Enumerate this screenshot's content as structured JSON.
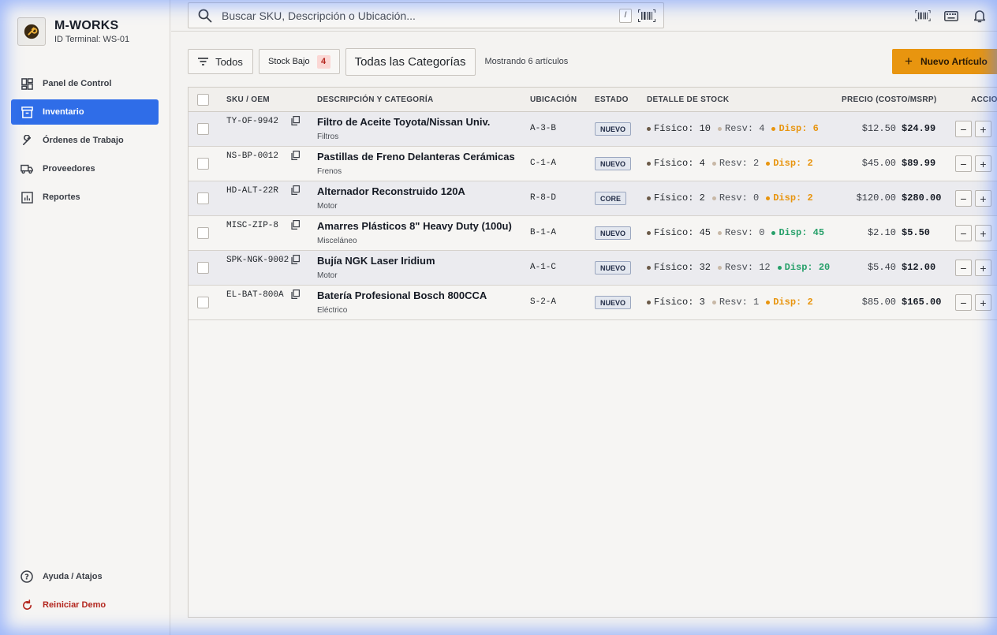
{
  "brand": {
    "name": "M-WORKS",
    "terminal": "ID Terminal: WS-01"
  },
  "nav": {
    "items": [
      {
        "label": "Panel de Control",
        "icon": "dashboard-icon"
      },
      {
        "label": "Inventario",
        "icon": "inventory-box-icon",
        "active": true
      },
      {
        "label": "Órdenes de Trabajo",
        "icon": "wrench-icon"
      },
      {
        "label": "Proveedores",
        "icon": "truck-icon"
      },
      {
        "label": "Reportes",
        "icon": "report-chart-icon"
      }
    ],
    "help": "Ayuda / Atajos",
    "reset": "Reiniciar Demo"
  },
  "search": {
    "placeholder": "Buscar SKU, Descripción o Ubicación...",
    "shortcut": "/"
  },
  "filters": {
    "all": "Todos",
    "low_stock": "Stock Bajo",
    "low_stock_count": "4",
    "categories": "Todas las Categorías",
    "showing": "Mostrando 6 artículos"
  },
  "new_item": "Nuevo Artículo",
  "columns": {
    "sku": "SKU / OEM",
    "desc": "DESCRIPCIÓN Y CATEGORÍA",
    "loc": "UBICACIÓN",
    "estado": "ESTADO",
    "stock": "DETALLE DE STOCK",
    "price": "PRECIO (COSTO/MSRP)",
    "actions": "ACCIO"
  },
  "rows": [
    {
      "sku": "TY-OF-9942",
      "desc": "Filtro de Aceite Toyota/Nissan Univ.",
      "cat": "Filtros",
      "loc": "A-3-B",
      "estado": "NUEVO",
      "fisico": "Físico: 10",
      "resv": "Resv: 4",
      "disp": "Disp: 6",
      "disp_status": "low",
      "cost": "$12.50",
      "msrp": "$24.99"
    },
    {
      "sku": "NS-BP-0012",
      "desc": "Pastillas de Freno Delanteras Cerámicas",
      "cat": "Frenos",
      "loc": "C-1-A",
      "estado": "NUEVO",
      "fisico": "Físico: 4",
      "resv": "Resv: 2",
      "disp": "Disp: 2",
      "disp_status": "low",
      "cost": "$45.00",
      "msrp": "$89.99"
    },
    {
      "sku": "HD-ALT-22R",
      "desc": "Alternador Reconstruido 120A",
      "cat": "Motor",
      "loc": "R-8-D",
      "estado": "CORE",
      "fisico": "Físico: 2",
      "resv": "Resv: 0",
      "disp": "Disp: 2",
      "disp_status": "low",
      "cost": "$120.00",
      "msrp": "$280.00"
    },
    {
      "sku": "MISC-ZIP-8",
      "desc": "Amarres Plásticos 8\" Heavy Duty (100u)",
      "cat": "Misceláneo",
      "loc": "B-1-A",
      "estado": "NUEVO",
      "fisico": "Físico: 45",
      "resv": "Resv: 0",
      "disp": "Disp: 45",
      "disp_status": "ok",
      "cost": "$2.10",
      "msrp": "$5.50"
    },
    {
      "sku": "SPK-NGK-9002",
      "desc": "Bujía NGK Laser Iridium",
      "cat": "Motor",
      "loc": "A-1-C",
      "estado": "NUEVO",
      "fisico": "Físico: 32",
      "resv": "Resv: 12",
      "disp": "Disp: 20",
      "disp_status": "ok",
      "cost": "$5.40",
      "msrp": "$12.00"
    },
    {
      "sku": "EL-BAT-800A",
      "desc": "Batería Profesional Bosch 800CCA",
      "cat": "Eléctrico",
      "loc": "S-2-A",
      "estado": "NUEVO",
      "fisico": "Físico: 3",
      "resv": "Resv: 1",
      "disp": "Disp: 2",
      "disp_status": "low",
      "cost": "$85.00",
      "msrp": "$165.00"
    }
  ],
  "colors": {
    "accent": "#2f6de8",
    "primary_action": "#e8950f",
    "low": "#e8950f",
    "ok": "#27a06a",
    "danger": "#b3261e"
  }
}
